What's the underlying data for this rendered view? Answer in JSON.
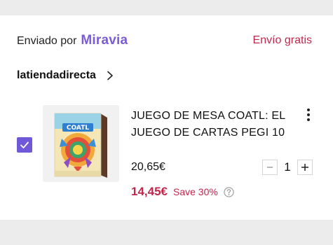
{
  "shipping": {
    "shipped_by_label": "Enviado por",
    "brand": "Miravia",
    "free_shipping": "Envío gratis"
  },
  "store": {
    "name": "latiendadirecta",
    "chevron_icon": "chevron-right-icon"
  },
  "item": {
    "selected": true,
    "image_text": "COATL",
    "title": "JUEGO DE MESA COATL: EL JUEGO DE CARTAS PEGI 10",
    "original_price": "20,65€",
    "sale_price": "14,45€",
    "save_text": "Save 30%",
    "quantity": "1"
  },
  "colors": {
    "brand": "#7b5cd6",
    "accent_red": "#c2264b",
    "checkbox": "#6f59d9"
  }
}
